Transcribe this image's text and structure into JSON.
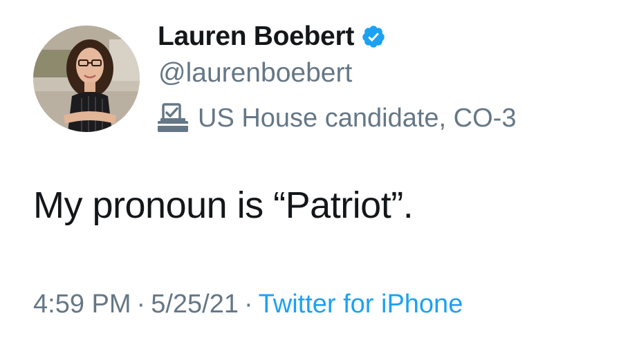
{
  "author": {
    "display_name": "Lauren Boebert",
    "handle": "@laurenboebert",
    "verified": true,
    "label": "US House candidate, CO-3",
    "label_icon": "ballot-box-icon"
  },
  "tweet": {
    "text": "My pronoun is “Patriot”."
  },
  "meta": {
    "time": "4:59 PM",
    "separator": "·",
    "date": "5/25/21",
    "source": "Twitter for iPhone"
  },
  "colors": {
    "text_primary": "#14171a",
    "text_secondary": "#657786",
    "accent_blue": "#1da1f2",
    "verified_blue": "#1da1f2"
  }
}
